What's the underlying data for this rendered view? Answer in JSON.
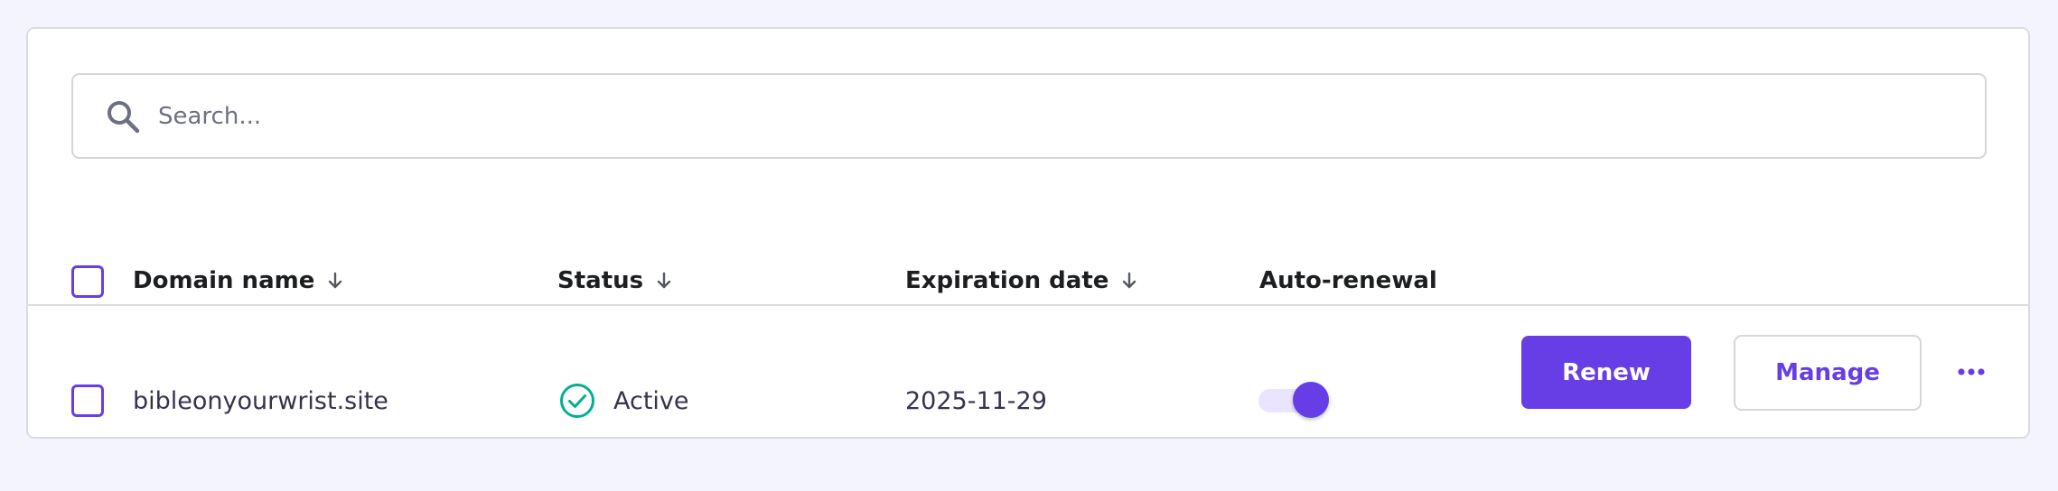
{
  "search": {
    "placeholder": "Search...",
    "value": ""
  },
  "table": {
    "headers": {
      "domain_name": "Domain name",
      "status": "Status",
      "expiration_date": "Expiration date",
      "auto_renewal": "Auto-renewal"
    },
    "rows": [
      {
        "domain": "bibleonyourwrist.site",
        "status": "Active",
        "expiration": "2025-11-29",
        "auto_renewal": true,
        "renew_label": "Renew",
        "manage_label": "Manage"
      }
    ]
  },
  "icons": {
    "search": "search-icon",
    "sort": "arrow-down-icon",
    "status": "check-circle-icon",
    "more": "more-horizontal-icon"
  },
  "colors": {
    "accent": "#673de6",
    "accent_light": "#ebe4ff",
    "success": "#00b090",
    "page_bg": "#f4f4fe",
    "border": "#dadce0"
  }
}
